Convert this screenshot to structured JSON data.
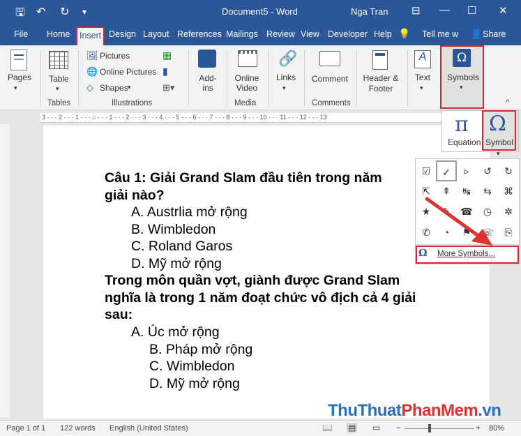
{
  "app": {
    "title": "Document5 - Word",
    "user": "Nga Tran"
  },
  "tabs": [
    "File",
    "Home",
    "Insert",
    "Design",
    "Layout",
    "References",
    "Mailings",
    "Review",
    "View",
    "Developer",
    "Help",
    "Tell me w",
    "Share"
  ],
  "ribbon": {
    "pages": "Pages",
    "table": "Table",
    "tables_group": "Tables",
    "pictures": "Pictures",
    "online_pictures": "Online Pictures",
    "shapes": "Shapes",
    "illustrations_group": "Illustrations",
    "addins": "Add-ins",
    "online_video": "Online Video",
    "media_group": "Media",
    "links": "Links",
    "comment": "Comment",
    "comments_group": "Comments",
    "header_footer": "Header & Footer",
    "text": "Text",
    "symbols": "Symbols"
  },
  "symbols_menu": {
    "equation": "Equation",
    "symbol": "Symbol",
    "more_symbols": "More Symbols...",
    "glyphs": [
      "☑",
      "✓",
      "▹",
      "↺",
      "↻",
      "⇱",
      "⇞",
      "↹",
      "⇆",
      "⌘",
      "★",
      "✎",
      "☎",
      "◷",
      "✲",
      "✆",
      "◔",
      "⚑",
      "☏",
      "⎘"
    ]
  },
  "document": {
    "lines": [
      "Câu 1: Giải Grand Slam đầu tiên trong năm",
      "giải nào?",
      "A. Austrlia mở rộng",
      "B. Wimbledon",
      "C. Roland Garos",
      "D. Mỹ mở rộng",
      "Trong môn quần vợt, giành được Grand Slam",
      "nghĩa là trong 1 năm đoạt chức vô địch cả 4 giải",
      "sau:",
      "A. Úc mở rộng",
      "B. Pháp mở rộng",
      "C. Wimbledon",
      "D. Mỹ mở rộng"
    ]
  },
  "status": {
    "page": "Page 1 of 1",
    "words": "122 words",
    "language": "English (United States)",
    "zoom": "80%"
  },
  "watermark": {
    "part1": "ThuThuat",
    "part2": "PhanMem",
    "part3": ".vn"
  },
  "colors": {
    "word_blue": "#2b579a",
    "highlight_red": "#d9272e"
  }
}
